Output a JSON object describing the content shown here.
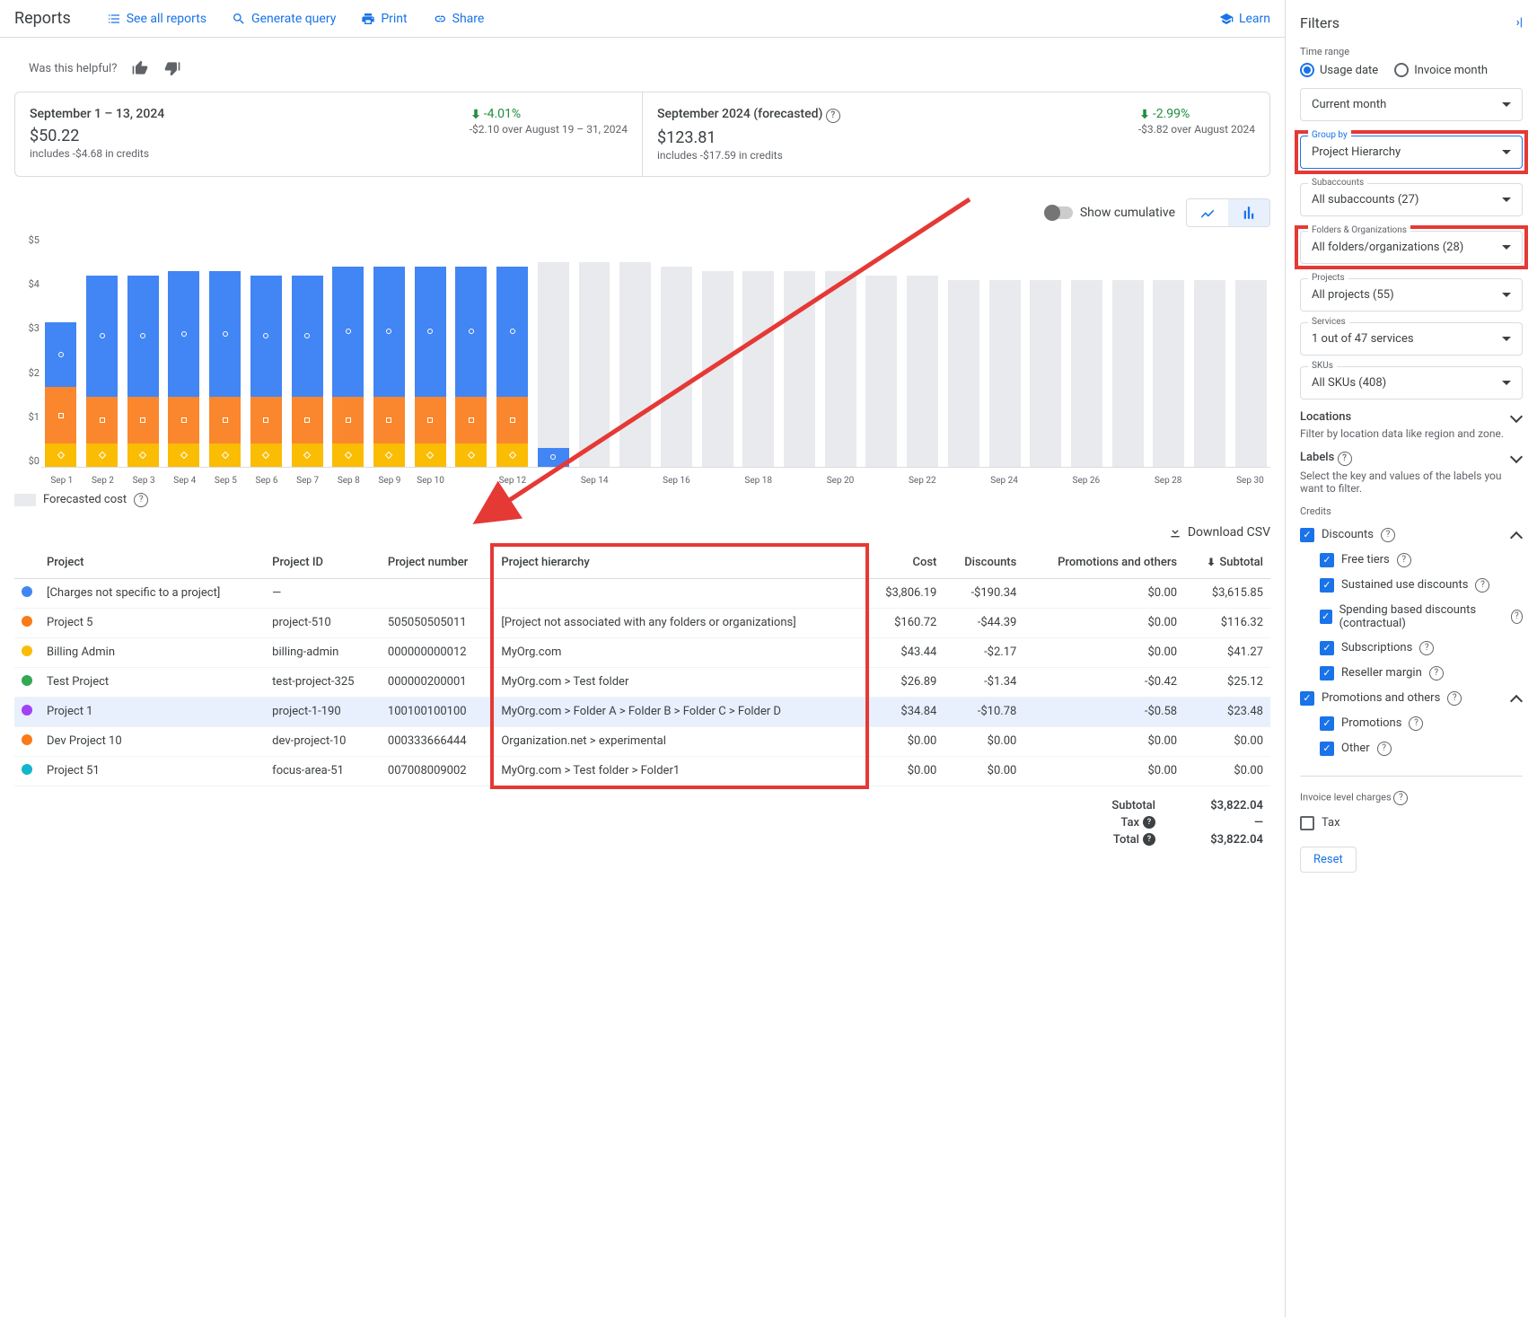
{
  "topbar": {
    "title": "Reports",
    "links": {
      "see_all": "See all reports",
      "generate": "Generate query",
      "print": "Print",
      "share": "Share",
      "learn": "Learn"
    }
  },
  "helpful": {
    "text": "Was this helpful?"
  },
  "summary": {
    "period1": {
      "title": "September 1 – 13, 2024",
      "amount": "$50.22",
      "sub": "includes -$4.68 in credits",
      "delta": "-4.01%",
      "delta_sub": "-$2.10 over August 19 – 31, 2024"
    },
    "period2": {
      "title": "September 2024 (forecasted)",
      "amount": "$123.81",
      "sub": "includes -$17.59 in credits",
      "delta": "-2.99%",
      "delta_sub": "-$3.82 over August 2024"
    }
  },
  "chart_ctrl": {
    "cumulative": "Show cumulative"
  },
  "chart_data": {
    "type": "bar",
    "ylabel": "$",
    "ylim": [
      0,
      5
    ],
    "y_ticks": [
      "$5",
      "$4",
      "$3",
      "$2",
      "$1",
      "$0"
    ],
    "categories": [
      "Sep 1",
      "Sep 2",
      "Sep 3",
      "Sep 4",
      "Sep 5",
      "Sep 6",
      "Sep 7",
      "Sep 8",
      "Sep 9",
      "Sep 10",
      "Sep 11",
      "Sep 12",
      "Sep 13",
      "Sep 14",
      "Sep 15",
      "Sep 16",
      "Sep 17",
      "Sep 18",
      "Sep 19",
      "Sep 20",
      "Sep 21",
      "Sep 22",
      "Sep 23",
      "Sep 24",
      "Sep 25",
      "Sep 26",
      "Sep 27",
      "Sep 28",
      "Sep 29",
      "Sep 30"
    ],
    "x_labels_shown": [
      "Sep 1",
      "Sep 2",
      "Sep 3",
      "Sep 4",
      "Sep 5",
      "Sep 6",
      "Sep 7",
      "Sep 8",
      "Sep 9",
      "Sep 10",
      "",
      "Sep 12",
      "",
      "Sep 14",
      "",
      "Sep 16",
      "",
      "Sep 18",
      "",
      "Sep 20",
      "",
      "Sep 22",
      "",
      "Sep 24",
      "",
      "Sep 26",
      "",
      "Sep 28",
      "",
      "Sep 30"
    ],
    "series": [
      {
        "name": "yellow",
        "values": [
          0.5,
          0.5,
          0.5,
          0.5,
          0.5,
          0.5,
          0.5,
          0.5,
          0.5,
          0.5,
          0.5,
          0.5,
          0,
          0,
          0,
          0,
          0,
          0,
          0,
          0,
          0,
          0,
          0,
          0,
          0,
          0,
          0,
          0,
          0,
          0
        ]
      },
      {
        "name": "orange",
        "values": [
          1.2,
          1.0,
          1.0,
          1.0,
          1.0,
          1.0,
          1.0,
          1.0,
          1.0,
          1.0,
          1.0,
          1.0,
          0,
          0,
          0,
          0,
          0,
          0,
          0,
          0,
          0,
          0,
          0,
          0,
          0,
          0,
          0,
          0,
          0,
          0
        ]
      },
      {
        "name": "blue",
        "values": [
          1.4,
          2.6,
          2.6,
          2.7,
          2.7,
          2.6,
          2.6,
          2.8,
          2.8,
          2.8,
          2.8,
          2.8,
          0.4,
          0,
          0,
          0,
          0,
          0,
          0,
          0,
          0,
          0,
          0,
          0,
          0,
          0,
          0,
          0,
          0,
          0
        ]
      },
      {
        "name": "forecast",
        "values": [
          0,
          0,
          0,
          0,
          0,
          0,
          0,
          0,
          0,
          0,
          0,
          0,
          4.0,
          4.4,
          4.4,
          4.3,
          4.2,
          4.2,
          4.2,
          4.2,
          4.1,
          4.1,
          4.0,
          4.0,
          4.0,
          4.0,
          4.0,
          4.0,
          4.0,
          4.0
        ]
      }
    ]
  },
  "legend": {
    "forecast": "Forecasted cost"
  },
  "download": "Download CSV",
  "table": {
    "headers": {
      "project": "Project",
      "project_id": "Project ID",
      "project_number": "Project number",
      "hierarchy": "Project hierarchy",
      "cost": "Cost",
      "discounts": "Discounts",
      "promotions": "Promotions and others",
      "subtotal": "Subtotal"
    },
    "rows": [
      {
        "color": "#4285f4",
        "project": "[Charges not specific to a project]",
        "project_id": "—",
        "project_number": "",
        "hierarchy": "",
        "cost": "$3,806.19",
        "discounts": "-$190.34",
        "promotions": "$0.00",
        "subtotal": "$3,615.85"
      },
      {
        "color": "#fa7b17",
        "project": "Project 5",
        "project_id": "project-510",
        "project_number": "505050505011",
        "hierarchy": "[Project not associated with any folders or organizations]",
        "cost": "$160.72",
        "discounts": "-$44.39",
        "promotions": "$0.00",
        "subtotal": "$116.32"
      },
      {
        "color": "#fbbc04",
        "project": "Billing Admin",
        "project_id": "billing-admin",
        "project_number": "000000000012",
        "hierarchy": "MyOrg.com",
        "cost": "$43.44",
        "discounts": "-$2.17",
        "promotions": "$0.00",
        "subtotal": "$41.27"
      },
      {
        "color": "#34a853",
        "project": "Test Project",
        "project_id": "test-project-325",
        "project_number": "000000200001",
        "hierarchy": "MyOrg.com > Test folder",
        "cost": "$26.89",
        "discounts": "-$1.34",
        "promotions": "-$0.42",
        "subtotal": "$25.12"
      },
      {
        "color": "#a142f4",
        "project": "Project 1",
        "project_id": "project-1-190",
        "project_number": "100100100100",
        "hierarchy": "MyOrg.com > Folder A > Folder B > Folder C > Folder D",
        "cost": "$34.84",
        "discounts": "-$10.78",
        "promotions": "-$0.58",
        "subtotal": "$23.48",
        "highlight": true
      },
      {
        "color": "#fa7b17",
        "project": "Dev Project 10",
        "project_id": "dev-project-10",
        "project_number": "000333666444",
        "hierarchy": "Organization.net > experimental",
        "cost": "$0.00",
        "discounts": "$0.00",
        "promotions": "$0.00",
        "subtotal": "$0.00"
      },
      {
        "color": "#12b5cb",
        "project": "Project 51",
        "project_id": "focus-area-51",
        "project_number": "007008009002",
        "hierarchy": "MyOrg.com > Test folder > Folder1",
        "cost": "$0.00",
        "discounts": "$0.00",
        "promotions": "$0.00",
        "subtotal": "$0.00"
      }
    ],
    "totals": {
      "subtotal_label": "Subtotal",
      "subtotal": "$3,822.04",
      "tax_label": "Tax",
      "tax": "—",
      "total_label": "Total",
      "total": "$3,822.04"
    }
  },
  "filters": {
    "title": "Filters",
    "time_range": "Time range",
    "usage_date": "Usage date",
    "invoice_month": "Invoice month",
    "current_month": "Current month",
    "group_by_label": "Group by",
    "group_by": "Project Hierarchy",
    "subaccounts_label": "Subaccounts",
    "subaccounts": "All subaccounts (27)",
    "folders_label": "Folders & Organizations",
    "folders": "All folders/organizations (28)",
    "projects_label": "Projects",
    "projects": "All projects (55)",
    "services_label": "Services",
    "services": "1 out of 47 services",
    "skus_label": "SKUs",
    "skus": "All SKUs (408)",
    "locations": "Locations",
    "locations_desc": "Filter by location data like region and zone.",
    "labels": "Labels",
    "labels_desc": "Select the key and values of the labels you want to filter.",
    "credits": "Credits",
    "discounts": "Discounts",
    "free_tiers": "Free tiers",
    "sustained": "Sustained use discounts",
    "spending": "Spending based discounts (contractual)",
    "subscriptions": "Subscriptions",
    "reseller": "Reseller margin",
    "promo_others": "Promotions and others",
    "promotions": "Promotions",
    "other": "Other",
    "invoice_charges": "Invoice level charges",
    "tax": "Tax",
    "reset": "Reset"
  }
}
